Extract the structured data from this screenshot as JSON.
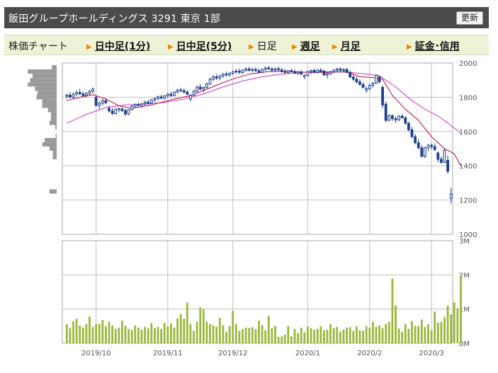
{
  "header": {
    "title": "飯田グループホールディングス  3291  東京 1部",
    "refresh_label": "更新"
  },
  "nav": {
    "label": "株価チャート",
    "items": [
      {
        "label": "日中足(1分)",
        "active": false
      },
      {
        "label": "日中足(5分)",
        "active": false
      },
      {
        "label": "日足",
        "active": true
      },
      {
        "label": "週足",
        "active": false
      },
      {
        "label": "月足",
        "active": false
      },
      {
        "label": "証金･信用",
        "active": false
      }
    ]
  },
  "colors": {
    "candle": "#1f3f8f",
    "ma_short": "#c0003c",
    "ma_long": "#cc33cc",
    "volume": "#9ab83c",
    "grid": "#c0c0c0"
  },
  "chart_data": [
    {
      "type": "candlestick",
      "price_range": [
        1000,
        2000
      ],
      "price_ticks": [
        "2000",
        "1800",
        "1600",
        "1400",
        "1200",
        "1000"
      ],
      "candles": [
        {
          "o": 1805,
          "h": 1822,
          "l": 1792,
          "c": 1812
        },
        {
          "o": 1812,
          "h": 1830,
          "l": 1800,
          "c": 1800
        },
        {
          "o": 1800,
          "h": 1828,
          "l": 1790,
          "c": 1818
        },
        {
          "o": 1818,
          "h": 1840,
          "l": 1808,
          "c": 1828
        },
        {
          "o": 1828,
          "h": 1850,
          "l": 1812,
          "c": 1820
        },
        {
          "o": 1820,
          "h": 1832,
          "l": 1802,
          "c": 1810
        },
        {
          "o": 1810,
          "h": 1830,
          "l": 1800,
          "c": 1822
        },
        {
          "o": 1822,
          "h": 1842,
          "l": 1812,
          "c": 1835
        },
        {
          "o": 1835,
          "h": 1858,
          "l": 1822,
          "c": 1848
        },
        {
          "o": 1800,
          "h": 1806,
          "l": 1745,
          "c": 1752
        },
        {
          "o": 1752,
          "h": 1775,
          "l": 1730,
          "c": 1765
        },
        {
          "o": 1765,
          "h": 1790,
          "l": 1752,
          "c": 1780
        },
        {
          "o": 1780,
          "h": 1790,
          "l": 1760,
          "c": 1768
        },
        {
          "o": 1735,
          "h": 1750,
          "l": 1710,
          "c": 1720
        },
        {
          "o": 1720,
          "h": 1738,
          "l": 1695,
          "c": 1705
        },
        {
          "o": 1705,
          "h": 1735,
          "l": 1700,
          "c": 1730
        },
        {
          "o": 1728,
          "h": 1740,
          "l": 1712,
          "c": 1732
        },
        {
          "o": 1732,
          "h": 1740,
          "l": 1715,
          "c": 1722
        },
        {
          "o": 1722,
          "h": 1732,
          "l": 1690,
          "c": 1702
        },
        {
          "o": 1702,
          "h": 1730,
          "l": 1695,
          "c": 1728
        },
        {
          "o": 1728,
          "h": 1755,
          "l": 1722,
          "c": 1748
        },
        {
          "o": 1748,
          "h": 1765,
          "l": 1738,
          "c": 1758
        },
        {
          "o": 1758,
          "h": 1770,
          "l": 1745,
          "c": 1752
        },
        {
          "o": 1752,
          "h": 1765,
          "l": 1740,
          "c": 1762
        },
        {
          "o": 1762,
          "h": 1780,
          "l": 1752,
          "c": 1772
        },
        {
          "o": 1772,
          "h": 1785,
          "l": 1758,
          "c": 1765
        },
        {
          "o": 1765,
          "h": 1790,
          "l": 1760,
          "c": 1784
        },
        {
          "o": 1784,
          "h": 1800,
          "l": 1772,
          "c": 1792
        },
        {
          "o": 1792,
          "h": 1810,
          "l": 1782,
          "c": 1802
        },
        {
          "o": 1802,
          "h": 1815,
          "l": 1788,
          "c": 1795
        },
        {
          "o": 1795,
          "h": 1812,
          "l": 1785,
          "c": 1808
        },
        {
          "o": 1808,
          "h": 1825,
          "l": 1795,
          "c": 1818
        },
        {
          "o": 1818,
          "h": 1832,
          "l": 1800,
          "c": 1810
        },
        {
          "o": 1810,
          "h": 1835,
          "l": 1805,
          "c": 1830
        },
        {
          "o": 1830,
          "h": 1850,
          "l": 1822,
          "c": 1842
        },
        {
          "o": 1842,
          "h": 1856,
          "l": 1830,
          "c": 1838
        },
        {
          "o": 1838,
          "h": 1852,
          "l": 1822,
          "c": 1830
        },
        {
          "o": 1830,
          "h": 1842,
          "l": 1812,
          "c": 1818
        },
        {
          "o": 1790,
          "h": 1818,
          "l": 1775,
          "c": 1812
        },
        {
          "o": 1812,
          "h": 1842,
          "l": 1805,
          "c": 1836
        },
        {
          "o": 1836,
          "h": 1868,
          "l": 1830,
          "c": 1860
        },
        {
          "o": 1860,
          "h": 1878,
          "l": 1840,
          "c": 1848
        },
        {
          "o": 1848,
          "h": 1862,
          "l": 1830,
          "c": 1858
        },
        {
          "o": 1858,
          "h": 1885,
          "l": 1850,
          "c": 1878
        },
        {
          "o": 1878,
          "h": 1915,
          "l": 1870,
          "c": 1905
        },
        {
          "o": 1905,
          "h": 1928,
          "l": 1895,
          "c": 1920
        },
        {
          "o": 1920,
          "h": 1935,
          "l": 1900,
          "c": 1912
        },
        {
          "o": 1912,
          "h": 1930,
          "l": 1900,
          "c": 1925
        },
        {
          "o": 1925,
          "h": 1942,
          "l": 1912,
          "c": 1935
        },
        {
          "o": 1935,
          "h": 1950,
          "l": 1920,
          "c": 1930
        },
        {
          "o": 1930,
          "h": 1945,
          "l": 1920,
          "c": 1940
        },
        {
          "o": 1940,
          "h": 1955,
          "l": 1930,
          "c": 1948
        },
        {
          "o": 1948,
          "h": 1965,
          "l": 1936,
          "c": 1952
        },
        {
          "o": 1952,
          "h": 1968,
          "l": 1935,
          "c": 1945
        },
        {
          "o": 1945,
          "h": 1962,
          "l": 1935,
          "c": 1958
        },
        {
          "o": 1958,
          "h": 1975,
          "l": 1948,
          "c": 1965
        },
        {
          "o": 1965,
          "h": 1978,
          "l": 1950,
          "c": 1958
        },
        {
          "o": 1958,
          "h": 1972,
          "l": 1945,
          "c": 1962
        },
        {
          "o": 1962,
          "h": 1975,
          "l": 1948,
          "c": 1955
        },
        {
          "o": 1955,
          "h": 1968,
          "l": 1940,
          "c": 1946
        },
        {
          "o": 1946,
          "h": 1968,
          "l": 1940,
          "c": 1962
        },
        {
          "o": 1962,
          "h": 1980,
          "l": 1952,
          "c": 1972
        },
        {
          "o": 1972,
          "h": 1982,
          "l": 1960,
          "c": 1965
        },
        {
          "o": 1965,
          "h": 1975,
          "l": 1950,
          "c": 1958
        },
        {
          "o": 1958,
          "h": 1972,
          "l": 1948,
          "c": 1966
        },
        {
          "o": 1966,
          "h": 1980,
          "l": 1955,
          "c": 1960
        },
        {
          "o": 1960,
          "h": 1972,
          "l": 1945,
          "c": 1952
        },
        {
          "o": 1952,
          "h": 1965,
          "l": 1938,
          "c": 1945
        },
        {
          "o": 1945,
          "h": 1960,
          "l": 1935,
          "c": 1955
        },
        {
          "o": 1955,
          "h": 1968,
          "l": 1944,
          "c": 1950
        },
        {
          "o": 1950,
          "h": 1962,
          "l": 1935,
          "c": 1940
        },
        {
          "o": 1940,
          "h": 1955,
          "l": 1928,
          "c": 1948
        },
        {
          "o": 1948,
          "h": 1960,
          "l": 1930,
          "c": 1935
        },
        {
          "o": 1920,
          "h": 1935,
          "l": 1905,
          "c": 1928
        },
        {
          "o": 1928,
          "h": 1955,
          "l": 1920,
          "c": 1948
        },
        {
          "o": 1948,
          "h": 1962,
          "l": 1935,
          "c": 1956
        },
        {
          "o": 1956,
          "h": 1968,
          "l": 1940,
          "c": 1945
        },
        {
          "o": 1945,
          "h": 1965,
          "l": 1938,
          "c": 1958
        },
        {
          "o": 1958,
          "h": 1970,
          "l": 1945,
          "c": 1952
        },
        {
          "o": 1952,
          "h": 1962,
          "l": 1925,
          "c": 1930
        },
        {
          "o": 1930,
          "h": 1945,
          "l": 1910,
          "c": 1938
        },
        {
          "o": 1938,
          "h": 1955,
          "l": 1930,
          "c": 1948
        },
        {
          "o": 1948,
          "h": 1965,
          "l": 1940,
          "c": 1958
        },
        {
          "o": 1958,
          "h": 1972,
          "l": 1945,
          "c": 1965
        },
        {
          "o": 1965,
          "h": 1975,
          "l": 1950,
          "c": 1958
        },
        {
          "o": 1958,
          "h": 1970,
          "l": 1948,
          "c": 1962
        },
        {
          "o": 1962,
          "h": 1972,
          "l": 1940,
          "c": 1945
        },
        {
          "o": 1945,
          "h": 1955,
          "l": 1912,
          "c": 1918
        },
        {
          "o": 1918,
          "h": 1932,
          "l": 1895,
          "c": 1905
        },
        {
          "o": 1905,
          "h": 1922,
          "l": 1880,
          "c": 1890
        },
        {
          "o": 1890,
          "h": 1905,
          "l": 1868,
          "c": 1875
        },
        {
          "o": 1875,
          "h": 1888,
          "l": 1850,
          "c": 1858
        },
        {
          "o": 1842,
          "h": 1862,
          "l": 1825,
          "c": 1850
        },
        {
          "o": 1850,
          "h": 1878,
          "l": 1840,
          "c": 1870
        },
        {
          "o": 1870,
          "h": 1890,
          "l": 1855,
          "c": 1882
        },
        {
          "o": 1882,
          "h": 1935,
          "l": 1878,
          "c": 1928
        },
        {
          "o": 1918,
          "h": 1928,
          "l": 1880,
          "c": 1890
        },
        {
          "o": 1858,
          "h": 1870,
          "l": 1738,
          "c": 1755
        },
        {
          "o": 1760,
          "h": 1775,
          "l": 1655,
          "c": 1665
        },
        {
          "o": 1665,
          "h": 1700,
          "l": 1660,
          "c": 1692
        },
        {
          "o": 1692,
          "h": 1700,
          "l": 1662,
          "c": 1675
        },
        {
          "o": 1675,
          "h": 1688,
          "l": 1650,
          "c": 1668
        },
        {
          "o": 1668,
          "h": 1695,
          "l": 1660,
          "c": 1690
        },
        {
          "o": 1690,
          "h": 1702,
          "l": 1675,
          "c": 1680
        },
        {
          "o": 1680,
          "h": 1690,
          "l": 1640,
          "c": 1648
        },
        {
          "o": 1648,
          "h": 1660,
          "l": 1600,
          "c": 1610
        },
        {
          "o": 1610,
          "h": 1628,
          "l": 1560,
          "c": 1570
        },
        {
          "o": 1570,
          "h": 1585,
          "l": 1525,
          "c": 1535
        },
        {
          "o": 1535,
          "h": 1555,
          "l": 1495,
          "c": 1505
        },
        {
          "o": 1505,
          "h": 1520,
          "l": 1448,
          "c": 1455
        },
        {
          "o": 1455,
          "h": 1512,
          "l": 1445,
          "c": 1505
        },
        {
          "o": 1505,
          "h": 1528,
          "l": 1485,
          "c": 1520
        },
        {
          "o": 1520,
          "h": 1530,
          "l": 1495,
          "c": 1512
        },
        {
          "o": 1512,
          "h": 1530,
          "l": 1485,
          "c": 1495
        },
        {
          "o": 1475,
          "h": 1482,
          "l": 1420,
          "c": 1438
        },
        {
          "o": 1438,
          "h": 1455,
          "l": 1412,
          "c": 1420
        },
        {
          "o": 1420,
          "h": 1500,
          "l": 1415,
          "c": 1490
        },
        {
          "o": 1432,
          "h": 1460,
          "l": 1352,
          "c": 1368
        },
        {
          "o": 1210,
          "h": 1272,
          "l": 1180,
          "c": 1235
        }
      ],
      "ma_short": [
        [
          0,
          1780
        ],
        [
          4,
          1800
        ],
        [
          8,
          1815
        ],
        [
          12,
          1790
        ],
        [
          16,
          1750
        ],
        [
          20,
          1735
        ],
        [
          26,
          1755
        ],
        [
          32,
          1785
        ],
        [
          38,
          1810
        ],
        [
          44,
          1855
        ],
        [
          50,
          1900
        ],
        [
          56,
          1935
        ],
        [
          62,
          1950
        ],
        [
          68,
          1950
        ],
        [
          74,
          1945
        ],
        [
          80,
          1945
        ],
        [
          86,
          1950
        ],
        [
          90,
          1920
        ],
        [
          94,
          1915
        ],
        [
          97,
          1905
        ],
        [
          100,
          1810
        ],
        [
          104,
          1730
        ],
        [
          108,
          1665
        ],
        [
          112,
          1570
        ],
        [
          116,
          1500
        ],
        [
          119,
          1470
        ],
        [
          121,
          1400
        ]
      ],
      "ma_long": [
        [
          0,
          1648
        ],
        [
          6,
          1700
        ],
        [
          12,
          1740
        ],
        [
          18,
          1755
        ],
        [
          24,
          1760
        ],
        [
          30,
          1770
        ],
        [
          36,
          1790
        ],
        [
          42,
          1820
        ],
        [
          48,
          1860
        ],
        [
          54,
          1895
        ],
        [
          60,
          1920
        ],
        [
          66,
          1935
        ],
        [
          72,
          1945
        ],
        [
          78,
          1950
        ],
        [
          84,
          1948
        ],
        [
          90,
          1940
        ],
        [
          96,
          1925
        ],
        [
          101,
          1860
        ],
        [
          106,
          1780
        ],
        [
          110,
          1730
        ],
        [
          114,
          1690
        ],
        [
          117,
          1650
        ],
        [
          121,
          1590
        ]
      ],
      "price_profile": [
        {
          "price": 1975,
          "weight": 0.1
        },
        {
          "price": 1950,
          "weight": 0.6
        },
        {
          "price": 1925,
          "weight": 0.5
        },
        {
          "price": 1900,
          "weight": 0.55
        },
        {
          "price": 1875,
          "weight": 0.6
        },
        {
          "price": 1850,
          "weight": 0.45
        },
        {
          "price": 1825,
          "weight": 0.4
        },
        {
          "price": 1800,
          "weight": 0.42
        },
        {
          "price": 1775,
          "weight": 0.3
        },
        {
          "price": 1750,
          "weight": 0.3
        },
        {
          "price": 1725,
          "weight": 0.18
        },
        {
          "price": 1700,
          "weight": 0.12
        },
        {
          "price": 1675,
          "weight": 0.12
        },
        {
          "price": 1650,
          "weight": 0.15
        },
        {
          "price": 1625,
          "weight": 0.03
        },
        {
          "price": 1575,
          "weight": 0.02
        },
        {
          "price": 1550,
          "weight": 0.25
        },
        {
          "price": 1525,
          "weight": 0.3
        },
        {
          "price": 1500,
          "weight": 0.15
        },
        {
          "price": 1475,
          "weight": 0.08
        },
        {
          "price": 1450,
          "weight": 0.08
        },
        {
          "price": 1250,
          "weight": 0.15
        }
      ]
    },
    {
      "type": "bar",
      "y_range": [
        0,
        3000000
      ],
      "volume_ticks": [
        "3M",
        "2M",
        "1M",
        "0M"
      ],
      "x_tick_labels": [
        {
          "label": "2019/10",
          "index": 9
        },
        {
          "label": "2019/11",
          "index": 31
        },
        {
          "label": "2019/12",
          "index": 51
        },
        {
          "label": "2020/1",
          "index": 74
        },
        {
          "label": "2020/2",
          "index": 93
        },
        {
          "label": "2020/3",
          "index": 112
        }
      ],
      "values": [
        550,
        450,
        640,
        720,
        520,
        460,
        560,
        780,
        480,
        560,
        560,
        680,
        500,
        630,
        520,
        420,
        460,
        660,
        510,
        420,
        390,
        520,
        460,
        400,
        480,
        440,
        590,
        440,
        480,
        420,
        600,
        490,
        580,
        460,
        730,
        850,
        720,
        1190,
        560,
        360,
        630,
        1050,
        1000,
        630,
        560,
        520,
        490,
        740,
        530,
        330,
        500,
        950,
        560,
        360,
        420,
        460,
        450,
        470,
        410,
        660,
        530,
        380,
        800,
        440,
        510,
        190,
        200,
        250,
        500,
        200,
        420,
        300,
        460,
        320,
        490,
        450,
        390,
        420,
        500,
        380,
        400,
        560,
        450,
        480,
        340,
        400,
        460,
        470,
        360,
        490,
        380,
        370,
        500,
        460,
        630,
        480,
        520,
        440,
        560,
        620,
        1890,
        1110,
        430,
        330,
        560,
        420,
        650,
        510,
        500,
        690,
        480,
        560,
        380,
        930,
        600,
        630,
        770,
        1100,
        850,
        1200,
        1030,
        1990
      ]
    }
  ]
}
